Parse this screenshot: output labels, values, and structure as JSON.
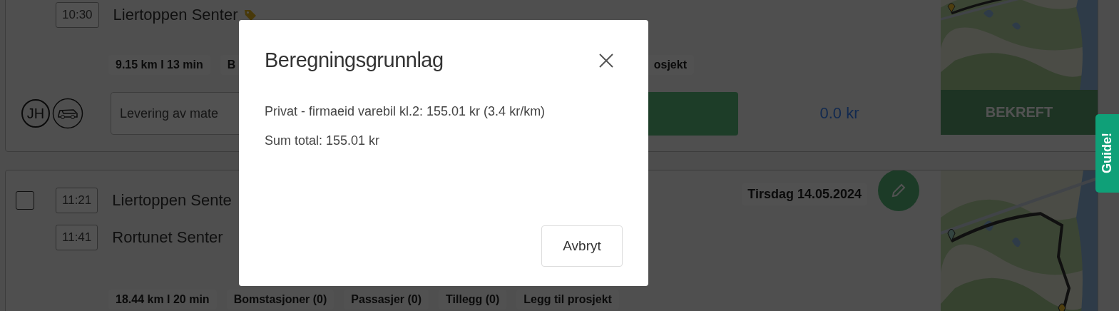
{
  "trips": [
    {
      "stops": [
        {
          "time": "10:30",
          "place": "Liertoppen Senter",
          "tagged": true
        }
      ],
      "chips": [
        "9.15 km I 13 min",
        "B",
        "osjekt"
      ],
      "driver": "JH",
      "description": "Levering av mate",
      "price": "0.0 kr",
      "confirm": "BEKREFT"
    },
    {
      "checked": false,
      "stops": [
        {
          "time": "11:21",
          "place": "Liertoppen Sente",
          "tagged": false
        },
        {
          "time": "11:41",
          "place": "Rortunet Senter",
          "tagged": false
        }
      ],
      "date": "Tirsdag 14.05.2024",
      "chips": [
        "18.44 km I 20 min",
        "Bomstasjoner (0)",
        "Passasjer (0)",
        "Tillegg (0)",
        "Legg til prosjekt"
      ]
    }
  ],
  "dialog": {
    "title": "Beregningsgrunnlag",
    "lines": [
      "Privat - firmaeid varebil kl.2: 155.01 kr (3.4 kr/km)",
      "Sum total: 155.01 kr"
    ],
    "buttons": [
      "Avbryt"
    ]
  },
  "guide_tab": "Guide!"
}
